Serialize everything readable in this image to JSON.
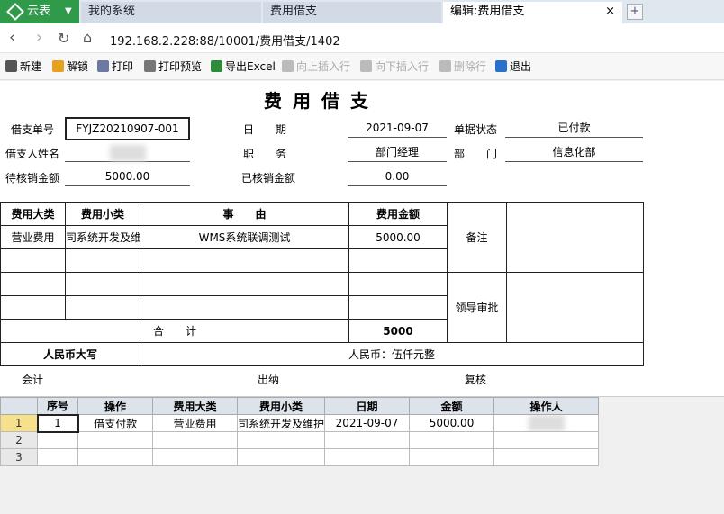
{
  "tabs": {
    "home": "云表",
    "sys": "我的系统",
    "expense": "费用借支",
    "edit": "编辑:费用借支",
    "close": "×",
    "add": "+"
  },
  "address": {
    "url": "192.168.2.228:88/10001/费用借支/1402"
  },
  "toolbar": [
    {
      "name": "new",
      "label": "新建",
      "enabled": true,
      "color": "#555"
    },
    {
      "name": "unlock",
      "label": "解锁",
      "enabled": true,
      "color": "#e8a020"
    },
    {
      "name": "print",
      "label": "打印",
      "enabled": true,
      "color": "#6a7aa0"
    },
    {
      "name": "print-preview",
      "label": "打印预览",
      "enabled": true,
      "color": "#777"
    },
    {
      "name": "export-excel",
      "label": "导出Excel",
      "enabled": true,
      "color": "#2e8b3a"
    },
    {
      "name": "insert-above",
      "label": "向上插入行",
      "enabled": false,
      "color": "#bbb"
    },
    {
      "name": "insert-below",
      "label": "向下插入行",
      "enabled": false,
      "color": "#bbb"
    },
    {
      "name": "delete-row",
      "label": "删除行",
      "enabled": false,
      "color": "#bbb"
    },
    {
      "name": "exit",
      "label": "退出",
      "enabled": true,
      "color": "#2a72c8"
    }
  ],
  "form": {
    "title": "费用借支",
    "labels": {
      "doc_no": "借支单号",
      "date": "日　　期",
      "status": "单据状态",
      "borrower": "借支人姓名",
      "position": "职　　务",
      "dept": "部　　门",
      "pending": "待核销金额",
      "verified": "已核销金额"
    },
    "values": {
      "doc_no": "FYJZ20210907-001",
      "date": "2021-09-07",
      "status": "已付款",
      "position": "部门经理",
      "dept": "信息化部",
      "pending": "5000.00",
      "verified": "0.00"
    },
    "table": {
      "headers": [
        "费用大类",
        "费用小类",
        "事　　由",
        "费用金额"
      ],
      "rows": [
        [
          "营业费用",
          "司系统开发及维",
          "WMS系统联调测试",
          "5000.00"
        ],
        [
          "",
          "",
          "",
          ""
        ],
        [
          "",
          "",
          "",
          ""
        ],
        [
          "",
          "",
          "",
          ""
        ]
      ],
      "remark_label": "备注",
      "approval_label": "领导审批",
      "total_label": "合　　计",
      "total_value": "5000",
      "rmb_label": "人民币大写",
      "rmb_value": "人民币：伍仟元整"
    },
    "sign": {
      "accounting": "会计",
      "cashier": "出纳",
      "review": "复核"
    }
  },
  "grid": {
    "headers": [
      "序号",
      "操作",
      "费用大类",
      "费用小类",
      "日期",
      "金额",
      "操作人"
    ],
    "rows": [
      [
        "1",
        "借支付款",
        "营业费用",
        "司系统开发及维护",
        "2021-09-07",
        "5000.00",
        ""
      ],
      [
        "",
        "",
        "",
        "",
        "",
        "",
        ""
      ],
      [
        "",
        "",
        "",
        "",
        "",
        "",
        ""
      ]
    ],
    "row_numbers": [
      "1",
      "2",
      "3"
    ]
  }
}
